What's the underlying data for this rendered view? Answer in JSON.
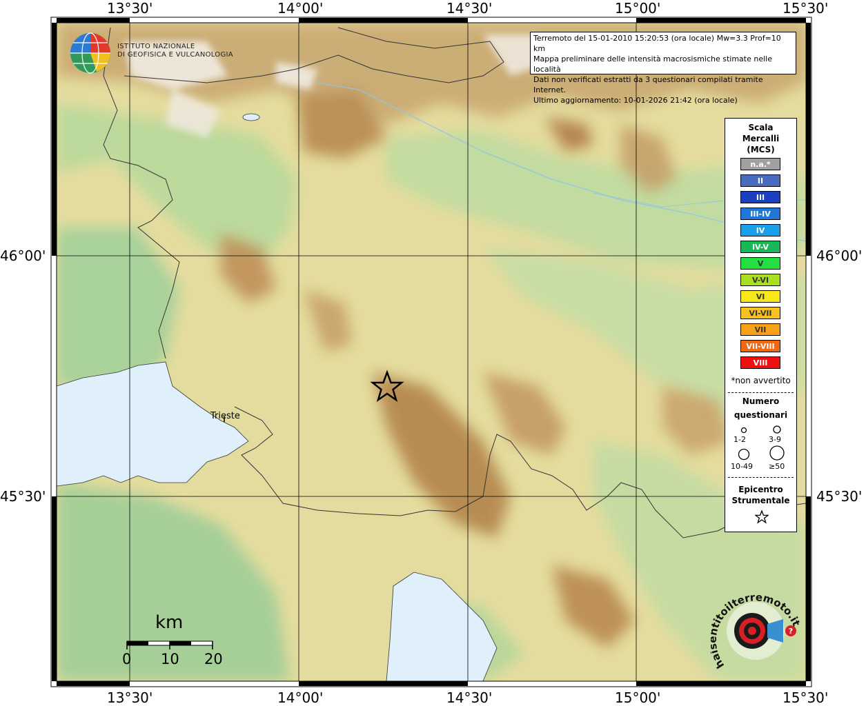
{
  "header": {
    "logo_line1": "ISTITUTO NAZIONALE",
    "logo_line2": "DI GEOFISICA E VULCANOLOGIA"
  },
  "info": {
    "line1": "Terremoto del 15-01-2010 15:20:53 (ora locale) Mw=3.3 Prof=10 km",
    "line2": "Mappa preliminare delle intensità macrosismiche stimate nelle località",
    "line3": "Dati non verificati estratti da 3 questionari compilati tramite Internet.",
    "line4": "Ultimo aggiornamento: 10-01-2026 21:42 (ora locale)"
  },
  "axes": {
    "top_ticks": [
      "13°30'",
      "14°00'",
      "14°30'",
      "15°00'",
      "15°30'"
    ],
    "bottom_ticks": [
      "13°30'",
      "14°00'",
      "14°30'",
      "15°00'",
      "15°30'"
    ],
    "left_ticks": [
      "46°00'",
      "45°30'"
    ],
    "right_ticks": [
      "46°00'",
      "45°30'"
    ]
  },
  "legend": {
    "title1": "Scala",
    "title2": "Mercalli",
    "title3": "(MCS)",
    "classes": [
      {
        "label": "n.a.*",
        "color": "#a0a0a0"
      },
      {
        "label": "II",
        "color": "#4a6cc0"
      },
      {
        "label": "III",
        "color": "#1a3fc0"
      },
      {
        "label": "III-IV",
        "color": "#1f78d8"
      },
      {
        "label": "IV",
        "color": "#1aa0e8"
      },
      {
        "label": "IV-V",
        "color": "#18b858"
      },
      {
        "label": "V",
        "color": "#22e040"
      },
      {
        "label": "V-VI",
        "color": "#a8e020"
      },
      {
        "label": "VI",
        "color": "#f8e818"
      },
      {
        "label": "VI-VII",
        "color": "#f8c020"
      },
      {
        "label": "VII",
        "color": "#f8a018"
      },
      {
        "label": "VII-VIII",
        "color": "#f06810"
      },
      {
        "label": "VIII",
        "color": "#f01010"
      }
    ],
    "not_felt_note": "*non avvertito",
    "count_title1": "Numero",
    "count_title2": "questionari",
    "count_labels": [
      "1-2",
      "3-9",
      "10-49",
      "≥50"
    ],
    "epicenter_title1": "Epicentro",
    "epicenter_title2": "Strumentale"
  },
  "map": {
    "city": "Trieste",
    "scale_title": "km",
    "scale_labels": [
      "0",
      "10",
      "20"
    ],
    "brand": "haisentitoilterremoto.it"
  },
  "colors": {
    "sea": "#dff0fb",
    "lowland": "#b9dba0",
    "hill": "#e6d89a",
    "mountain": "#b8884e",
    "peak": "#f2ede6"
  }
}
